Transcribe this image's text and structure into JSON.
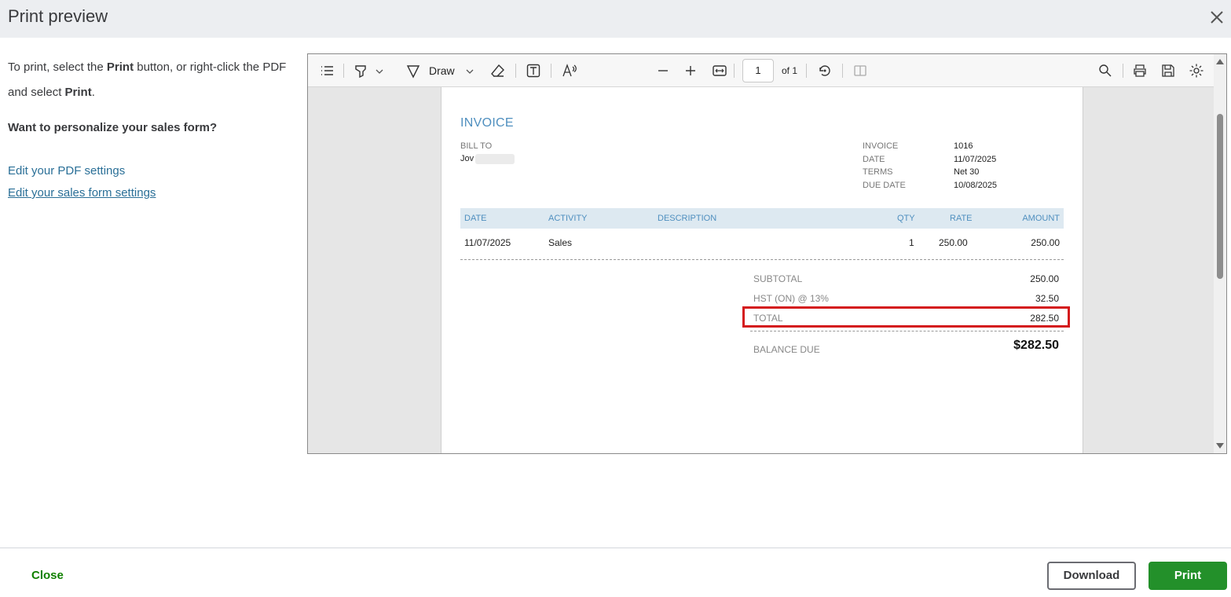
{
  "dialog": {
    "title": "Print preview",
    "close_icon": "close-icon"
  },
  "instructions": {
    "line_pre": "To print, select the ",
    "print_word": "Print",
    "line_mid": " button, or right-click the PDF and select ",
    "print_word2": "Print",
    "line_end": ".",
    "personalize": "Want to personalize your sales form?",
    "link_pdf": "Edit your PDF settings",
    "link_sales": "Edit your sales form settings"
  },
  "toolbar": {
    "draw_label": "Draw",
    "page_current": "1",
    "page_of": "of 1",
    "icons": [
      "contents-icon",
      "highlight-icon",
      "chevron-down-icon",
      "draw-icon",
      "chevron-down-icon",
      "eraser-icon",
      "text-box-icon",
      "read-aloud-icon",
      "zoom-out-icon",
      "zoom-in-icon",
      "fit-width-icon",
      "rotate-icon",
      "page-view-icon",
      "search-icon",
      "print-icon",
      "save-icon",
      "settings-icon"
    ]
  },
  "invoice": {
    "title": "INVOICE",
    "bill_to_label": "BILL TO",
    "bill_to_name": "Jov",
    "meta": [
      {
        "label": "INVOICE",
        "value": "1016"
      },
      {
        "label": "DATE",
        "value": "11/07/2025"
      },
      {
        "label": "TERMS",
        "value": "Net 30"
      },
      {
        "label": "DUE DATE",
        "value": "10/08/2025"
      }
    ],
    "columns": [
      "DATE",
      "ACTIVITY",
      "DESCRIPTION",
      "QTY",
      "RATE",
      "AMOUNT"
    ],
    "rows": [
      {
        "date": "11/07/2025",
        "activity": "Sales",
        "description": "",
        "qty": "1",
        "rate": "250.00",
        "amount": "250.00"
      }
    ],
    "subtotal_label": "SUBTOTAL",
    "subtotal_value": "250.00",
    "tax_label": "HST (ON) @ 13%",
    "tax_value": "32.50",
    "total_label": "TOTAL",
    "total_value": "282.50",
    "balance_label": "BALANCE DUE",
    "balance_value": "$282.50",
    "highlight_color": "#d4191c"
  },
  "footer": {
    "close_label": "Close",
    "download_label": "Download",
    "print_label": "Print"
  }
}
